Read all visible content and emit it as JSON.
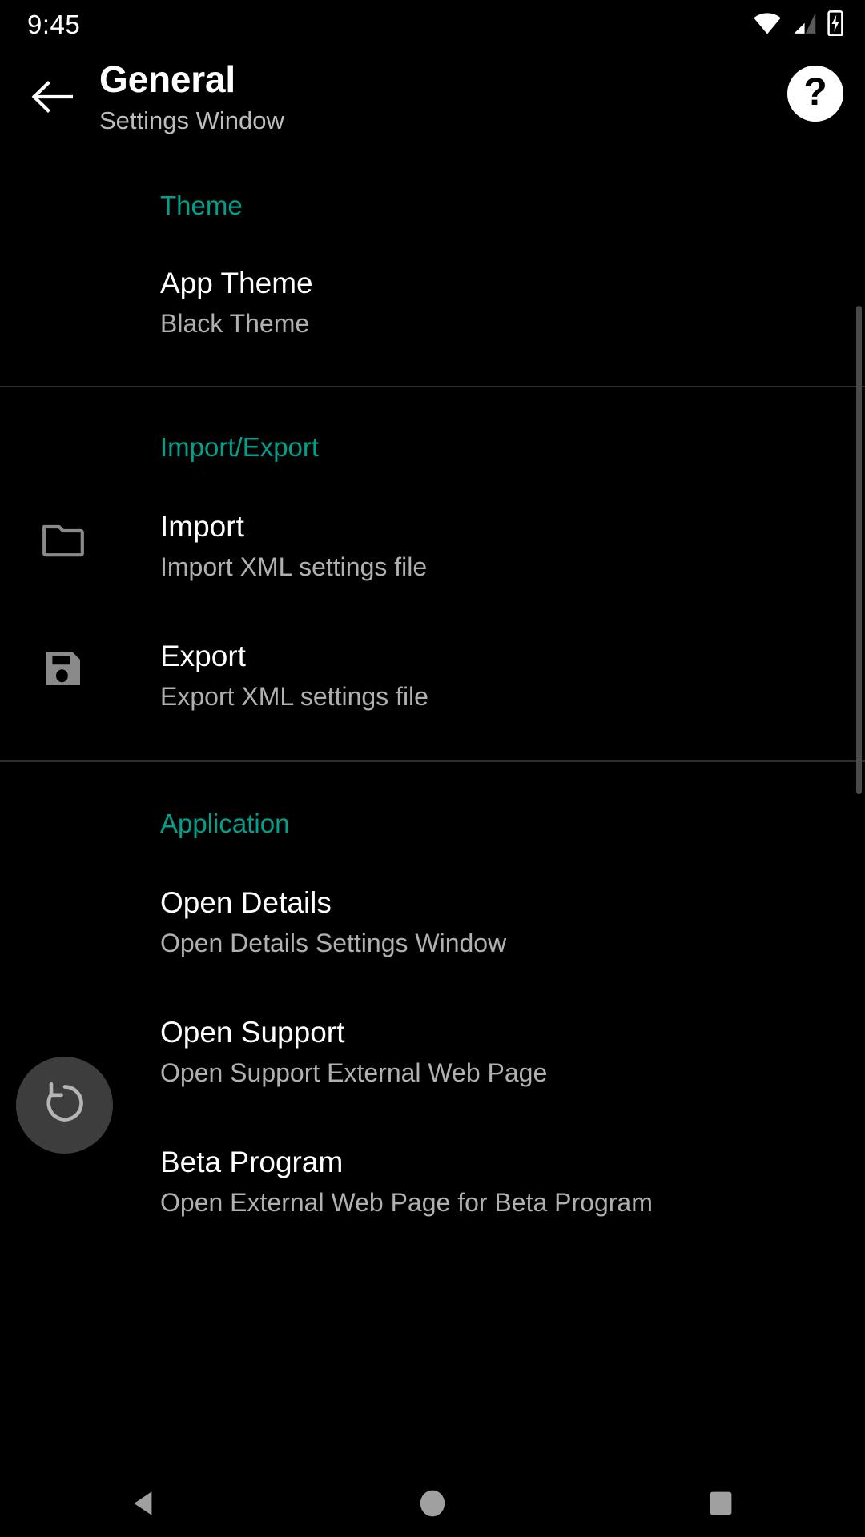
{
  "status_bar": {
    "time": "9:45",
    "icons": [
      "wifi-icon",
      "cellular-signal-icon",
      "battery-charging-icon"
    ]
  },
  "app_bar": {
    "back_icon": "arrow-left-icon",
    "title": "General",
    "subtitle": "Settings Window",
    "help_icon": "help-circle-icon",
    "help_glyph": "?"
  },
  "colors": {
    "background": "#000000",
    "section_header": "#00a08a",
    "primary_text": "#ffffff",
    "secondary_text": "#b0b0b0",
    "icon": "#8a8a8a",
    "divider": "#2e2e2e",
    "fab_background": "#3d3d3d",
    "nav_icon": "#a0a0a0"
  },
  "sections": [
    {
      "header": "Theme",
      "items": [
        {
          "icon": null,
          "title": "App Theme",
          "subtitle": "Black Theme"
        }
      ]
    },
    {
      "header": "Import/Export",
      "items": [
        {
          "icon": "folder-icon",
          "title": "Import",
          "subtitle": "Import XML settings file"
        },
        {
          "icon": "save-floppy-icon",
          "title": "Export",
          "subtitle": "Export XML settings file"
        }
      ]
    },
    {
      "header": "Application",
      "items": [
        {
          "icon": null,
          "title": "Open Details",
          "subtitle": "Open Details Settings Window"
        },
        {
          "icon": null,
          "title": "Open Support",
          "subtitle": "Open Support External Web Page"
        },
        {
          "icon": null,
          "title": "Beta Program",
          "subtitle": "Open External Web Page for Beta Program"
        }
      ]
    }
  ],
  "fab": {
    "icon": "restore-undo-icon"
  },
  "nav_bar": {
    "buttons": [
      {
        "icon": "nav-back-triangle-icon"
      },
      {
        "icon": "nav-home-circle-icon"
      },
      {
        "icon": "nav-recents-square-icon"
      }
    ]
  }
}
